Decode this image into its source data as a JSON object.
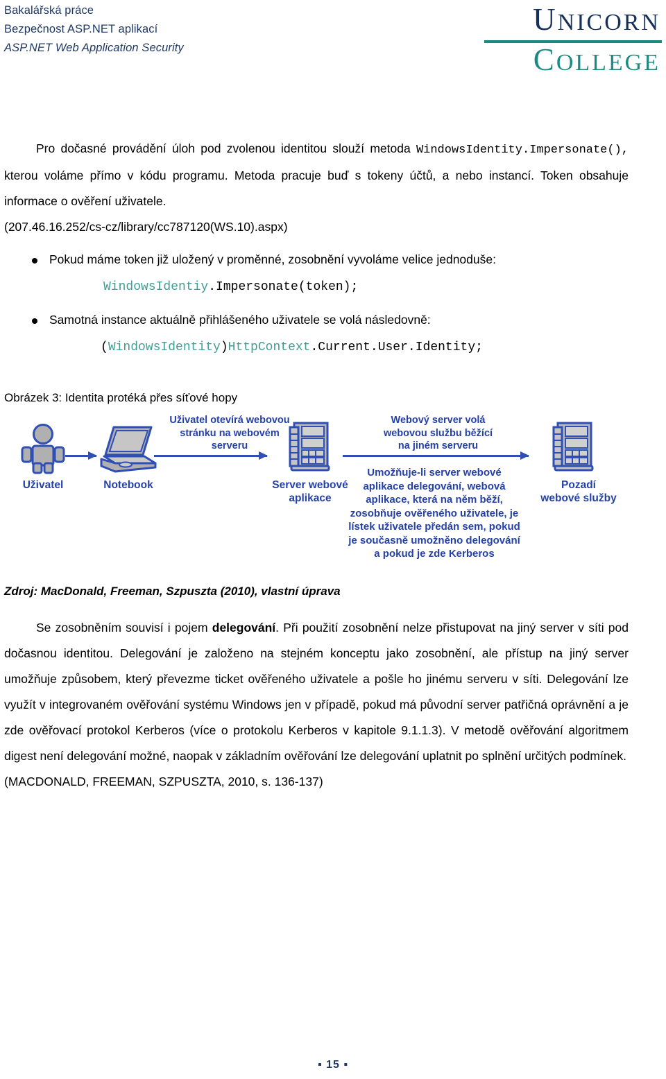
{
  "header": {
    "lines": [
      "Bakalářská práce",
      "Bezpečnost ASP.NET aplikací",
      "ASP.NET Web Application Security"
    ],
    "color": "#1f3864",
    "logo": {
      "top_word": "UNICORN",
      "bottom_word": "COLLEGE",
      "top_color": "#16305c",
      "bottom_color": "#1a8a83",
      "rule_color": "#1a8a83"
    }
  },
  "body": {
    "paragraph_1": {
      "text_before_code": "Pro dočasné provádění úloh pod zvolenou identitou slouží metoda ",
      "code": "WindowsIdentity.Impersonate(),",
      "text_after_code": " kterou voláme přímo v kódu programu. Metoda pracuje buď s tokeny účtů, a nebo instancí. Token obsahuje informace o ověření uživatele."
    },
    "source_url_line": "(207.46.16.252/cs-cz/library/cc787120(WS.10).aspx)",
    "bullets": [
      {
        "text": "Pokud máme token již uložený v proměnné, zosobnění vyvoláme velice jednoduše:",
        "code_type": "WindowsIdentiy",
        "code_rest": ".Impersonate(token);"
      },
      {
        "text": "Samotná instance aktuálně přihlášeného uživatele se volá následovně:",
        "code_prefix": "(",
        "code_type": "WindowsIdentity",
        "code_mid": ")",
        "code_type2": "HttpContext",
        "code_rest": ".Current.User.Identity;"
      }
    ],
    "code_accent_color": "#3f9e95"
  },
  "figure": {
    "caption": "Obrázek 3: Identita protéká přes síťové hopy",
    "source": "Zdroj: MacDonald, Freeman, Szpuszta (2010), vlastní úprava",
    "diagram": {
      "accent_color": "#2541a8",
      "arrow_color": "#2f4fb5",
      "icon_fill": "#b3b3b3",
      "nodes": [
        {
          "icon": "person-icon",
          "label": "Uživatel"
        },
        {
          "icon": "laptop-icon",
          "label": "Notebook"
        },
        {
          "icon": "server-rack-icon",
          "label": "Server webové\naplikace"
        },
        {
          "icon": "server-rack-icon",
          "label": "Pozadí\nwebové služby"
        }
      ],
      "arrow_labels": [
        "Uživatel otevírá webovou\nstránku na webovém\nserveru",
        "Webový server volá\nwebovou službu běžící\nna jiném serveru"
      ],
      "note": "Umožňuje-li server webové\naplikace delegování, webová\naplikace, která na něm běží,\nzosobňuje ověřeného uživatele, je\nlístek uživatele předán sem, pokud\nje současně umožněno delegování\na pokud je zde Kerberos"
    }
  },
  "tail": {
    "p1_a": "Se zosobněním souvisí i pojem ",
    "p1_bold": "delegování",
    "p1_b": ". Při použití zosobnění nelze přistupovat na jiný server v síti pod dočasnou identitou. Delegování je založeno na stejném konceptu jako zosobnění, ale přístup na jiný server umožňuje způsobem, který převezme ticket ověřeného uživatele a pošle ho jinému serveru v síti. Delegování lze využít v integrovaném ověřování systému Windows jen v případě, pokud má původní server patřičná oprávnění a je zde ověřovací protokol Kerberos (více o protokolu Kerberos v kapitole 9.1.1.3). V metodě ověřování algoritmem digest není delegování možné, naopak v základním ověřování lze delegování uplatnit po splnění určitých podmínek.",
    "citation": "(MACDONALD, FREEMAN, SZPUSZTA, 2010, s. 136-137)"
  },
  "footer": {
    "page_number": "▪ 15 ▪"
  }
}
